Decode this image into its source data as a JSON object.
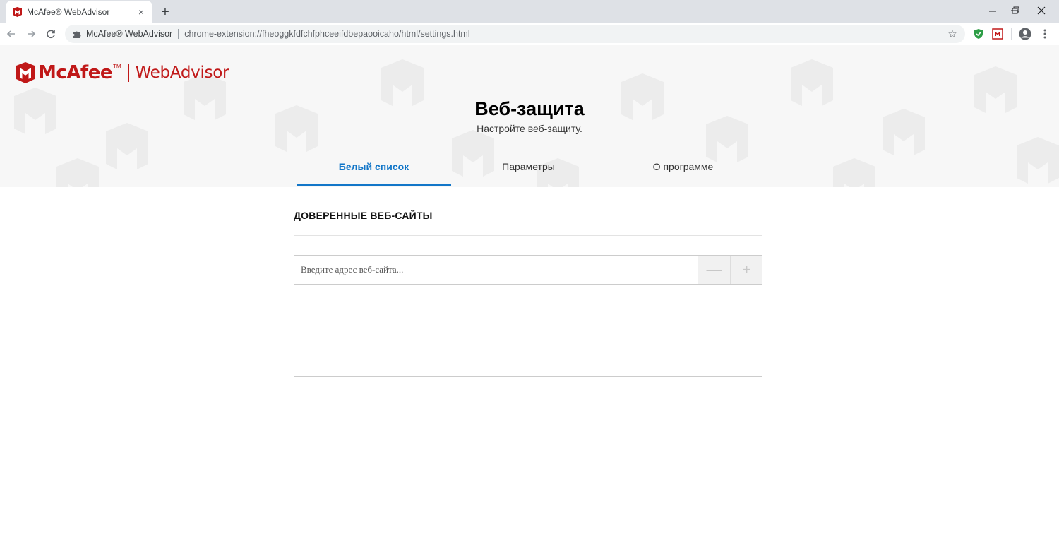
{
  "browser": {
    "tab": {
      "title": "McAfee® WebAdvisor",
      "close": "×"
    },
    "new_tab": "+",
    "omnibox": {
      "site_name": "McAfee® WebAdvisor",
      "url": "chrome-extension://fheoggkfdfchfphceeifdbepaooicaho/html/settings.html"
    }
  },
  "brand": {
    "name": "McAfee",
    "tm": "TM",
    "product": "WebAdvisor",
    "color": "#c01818"
  },
  "page": {
    "title": "Веб-защита",
    "subtitle": "Настройте веб-защиту."
  },
  "tabs": [
    {
      "label": "Белый список",
      "active": true
    },
    {
      "label": "Параметры",
      "active": false
    },
    {
      "label": "О программе",
      "active": false
    }
  ],
  "trusted_sites": {
    "heading": "ДОВЕРЕННЫЕ ВЕБ-САЙТЫ",
    "input_placeholder": "Введите адрес веб-сайта...",
    "remove_label": "—",
    "add_label": "+",
    "items": []
  },
  "colors": {
    "accent": "#1276c8",
    "brand_red": "#c01818"
  }
}
